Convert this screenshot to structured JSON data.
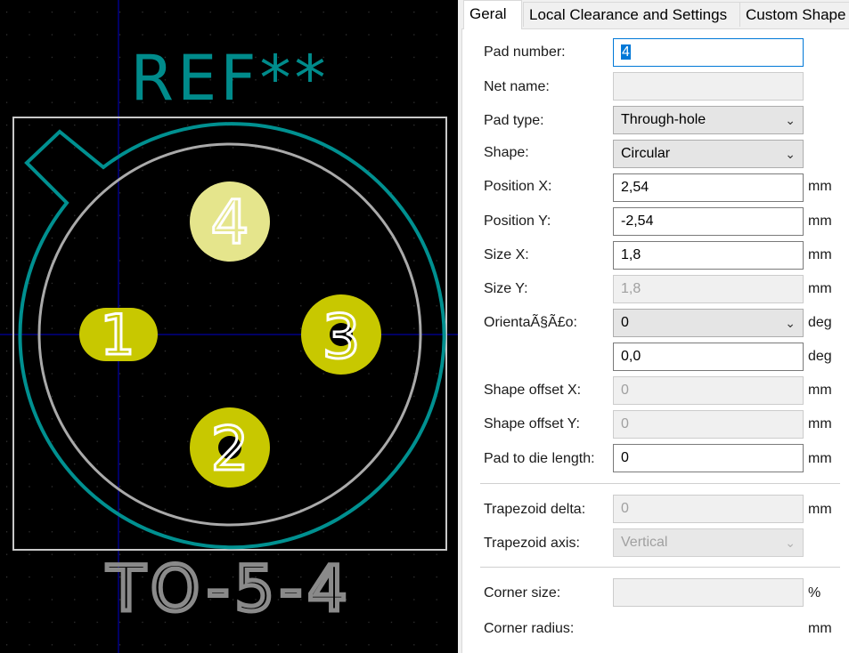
{
  "footprint": {
    "reference": "REF**",
    "value": "TO-5-4",
    "pads": [
      {
        "number": "4"
      },
      {
        "number": "1"
      },
      {
        "number": "3"
      },
      {
        "number": "2"
      }
    ],
    "colors": {
      "background": "#000000",
      "fab_text": "#008b8b",
      "courtyard_outline": "#c8c8c8",
      "pad_selected": "#e5e58c",
      "pad": "#c8c800",
      "silkscreen": "#009090",
      "grid_axis": "#0000c8"
    }
  },
  "dialog": {
    "tabs": [
      "Geral",
      "Local Clearance and Settings",
      "Custom Shape"
    ],
    "active_tab": "Geral",
    "fields": {
      "pad_number": {
        "label": "Pad number:",
        "value": "4"
      },
      "net_name": {
        "label": "Net name:",
        "value": ""
      },
      "pad_type": {
        "label": "Pad type:",
        "value": "Through-hole"
      },
      "shape": {
        "label": "Shape:",
        "value": "Circular"
      },
      "position_x": {
        "label": "Position X:",
        "value": "2,54",
        "unit": "mm"
      },
      "position_y": {
        "label": "Position Y:",
        "value": "-2,54",
        "unit": "mm"
      },
      "size_x": {
        "label": "Size X:",
        "value": "1,8",
        "unit": "mm"
      },
      "size_y": {
        "label": "Size Y:",
        "value": "1,8",
        "unit": "mm"
      },
      "orientation": {
        "label": "OrientaÃ§Ã£o:",
        "value": "0",
        "unit": "deg"
      },
      "orientation_custom": {
        "value": "0,0",
        "unit": "deg"
      },
      "shape_offset_x": {
        "label": "Shape offset X:",
        "value": "0",
        "unit": "mm"
      },
      "shape_offset_y": {
        "label": "Shape offset Y:",
        "value": "0",
        "unit": "mm"
      },
      "pad_to_die": {
        "label": "Pad to die length:",
        "value": "0",
        "unit": "mm"
      },
      "trapezoid_delta": {
        "label": "Trapezoid delta:",
        "value": "0",
        "unit": "mm"
      },
      "trapezoid_axis": {
        "label": "Trapezoid axis:",
        "value": "Vertical"
      },
      "corner_size": {
        "label": "Corner size:",
        "value": "",
        "unit": "%"
      },
      "corner_radius": {
        "label": "Corner radius:",
        "unit": "mm"
      }
    },
    "icons": {
      "dropdown": "chevron-down-icon"
    }
  }
}
